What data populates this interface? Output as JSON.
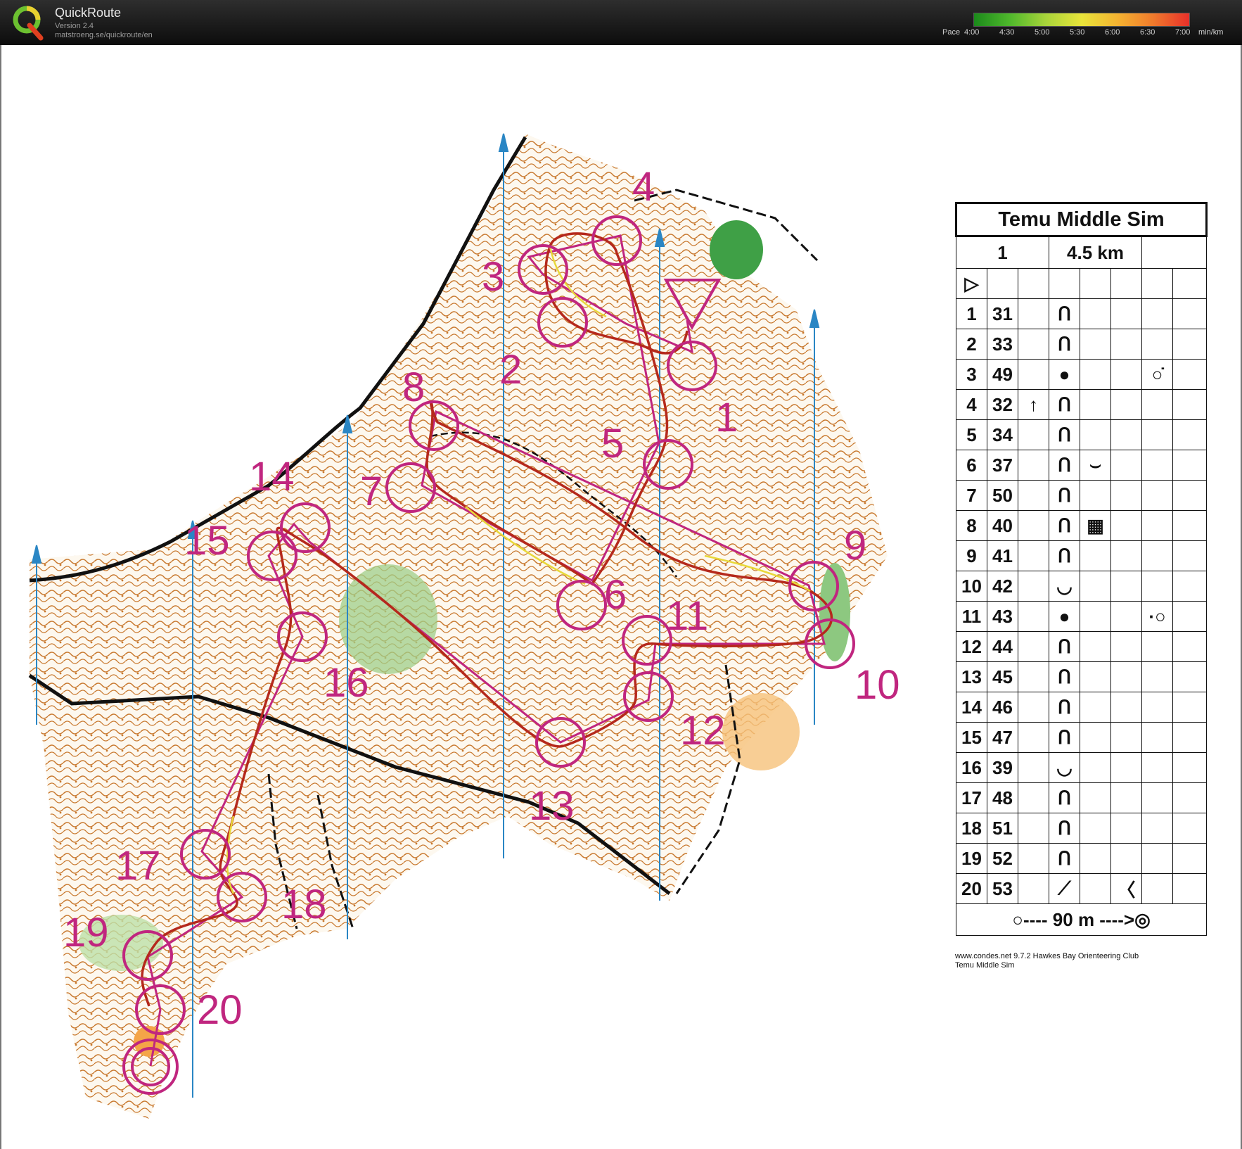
{
  "app": {
    "title": "QuickRoute",
    "version": "Version 2.4",
    "url": "matstroeng.se/quickroute/en"
  },
  "pace_legend": {
    "prefix": "Pace",
    "ticks": [
      "4:00",
      "4:30",
      "5:00",
      "5:30",
      "6:00",
      "6:30",
      "7:00"
    ],
    "unit": "min/km",
    "colors": [
      "#1b8a1b",
      "#4fb82c",
      "#a8d43a",
      "#e8e43a",
      "#f4b331",
      "#f07a2c",
      "#e8302a"
    ]
  },
  "map": {
    "control_numbers": [
      "1",
      "2",
      "3",
      "4",
      "5",
      "6",
      "7",
      "8",
      "9",
      "10",
      "11",
      "12",
      "13",
      "14",
      "15",
      "16",
      "17",
      "18",
      "19",
      "20"
    ],
    "course_color": "#c0267f",
    "route_color": "#b5291c"
  },
  "description_sheet": {
    "event_title": "Temu Middle Sim",
    "course": "1",
    "length": "4.5 km",
    "start_symbol": "▷",
    "controls": [
      {
        "num": "1",
        "code": "31",
        "c": "",
        "d": "ᑎ",
        "e": "",
        "g": ""
      },
      {
        "num": "2",
        "code": "33",
        "c": "",
        "d": "ᑎ",
        "e": "",
        "g": ""
      },
      {
        "num": "3",
        "code": "49",
        "c": "",
        "d": "●",
        "e": "",
        "g": "○̇"
      },
      {
        "num": "4",
        "code": "32",
        "c": "↑",
        "d": "ᑎ",
        "e": "",
        "g": ""
      },
      {
        "num": "5",
        "code": "34",
        "c": "",
        "d": "ᑎ",
        "e": "",
        "g": ""
      },
      {
        "num": "6",
        "code": "37",
        "c": "",
        "d": "ᑎ",
        "e": "⌣",
        "g": ""
      },
      {
        "num": "7",
        "code": "50",
        "c": "",
        "d": "ᑎ",
        "e": "",
        "g": ""
      },
      {
        "num": "8",
        "code": "40",
        "c": "",
        "d": "ᑎ",
        "e": "▦",
        "g": ""
      },
      {
        "num": "9",
        "code": "41",
        "c": "",
        "d": "ᑎ",
        "e": "",
        "g": ""
      },
      {
        "num": "10",
        "code": "42",
        "c": "",
        "d": "◡",
        "e": "",
        "g": ""
      },
      {
        "num": "11",
        "code": "43",
        "c": "",
        "d": "●",
        "e": "",
        "g": "·○"
      },
      {
        "num": "12",
        "code": "44",
        "c": "",
        "d": "ᑎ",
        "e": "",
        "g": ""
      },
      {
        "num": "13",
        "code": "45",
        "c": "",
        "d": "ᑎ",
        "e": "",
        "g": ""
      },
      {
        "num": "14",
        "code": "46",
        "c": "",
        "d": "ᑎ",
        "e": "",
        "g": ""
      },
      {
        "num": "15",
        "code": "47",
        "c": "",
        "d": "ᑎ",
        "e": "",
        "g": ""
      },
      {
        "num": "16",
        "code": "39",
        "c": "",
        "d": "◡",
        "e": "",
        "g": ""
      },
      {
        "num": "17",
        "code": "48",
        "c": "",
        "d": "ᑎ",
        "e": "",
        "g": ""
      },
      {
        "num": "18",
        "code": "51",
        "c": "",
        "d": "ᑎ",
        "e": "",
        "g": ""
      },
      {
        "num": "19",
        "code": "52",
        "c": "",
        "d": "ᑎ",
        "e": "",
        "g": ""
      },
      {
        "num": "20",
        "code": "53",
        "c": "",
        "d": "⟋",
        "e": "",
        "f": "〈",
        "g": ""
      }
    ],
    "finish": "○---- 90 m ---->◎",
    "footer_line1": "www.condes.net 9.7.2 Hawkes Bay Orienteering Club",
    "footer_line2": "Temu Middle Sim"
  }
}
